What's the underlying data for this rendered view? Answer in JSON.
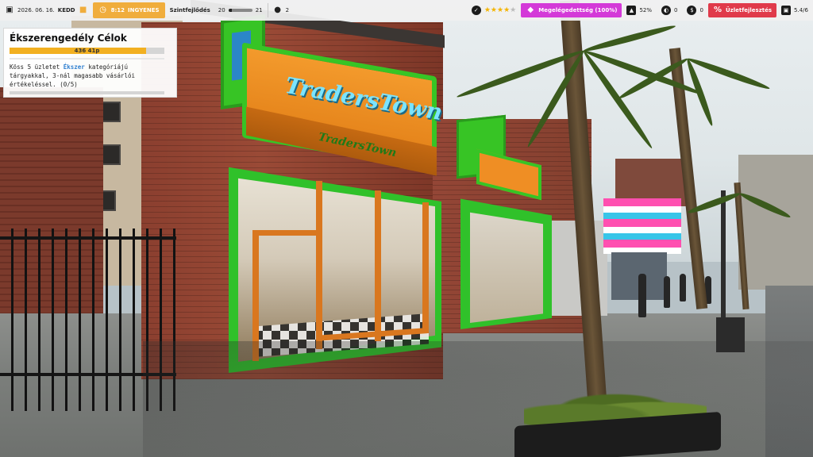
{
  "hud": {
    "date": "2026. 06. 16.",
    "weekday": "KEDD",
    "time": "8:12",
    "time_status": "INGYENES",
    "level_label": "Szintfejlődés",
    "level_current": "20",
    "level_next": "21",
    "level_progress": 0.15,
    "customers": "2",
    "rating_stars": 4,
    "rating_max": 5,
    "magenta_pill": "Megelégedettség (100%)",
    "popularity": "52%",
    "counter_a": "0",
    "counter_b": "0",
    "red_pill": "Üzletfejlesztés",
    "money": "5.4/6"
  },
  "objective": {
    "title": "Ékszerengedély Célok",
    "progress_label": "436 41p",
    "progress": 0.88,
    "desc_before": "Köss 5 üzletet ",
    "desc_link": "Ékszer",
    "desc_after": " kategóriájú tárgyakkal, 3-nál magasabb vásárlói értékeléssel. (0/5)"
  },
  "scene": {
    "store_sign": "TradersTown",
    "awning_sign": "TradersTown"
  },
  "colors": {
    "accent": "#f0ad3c",
    "magenta": "#d43ad8",
    "red": "#e03a4a",
    "link": "#2f7fd0",
    "store_green": "#37c425",
    "store_orange": "#f39a2c"
  }
}
